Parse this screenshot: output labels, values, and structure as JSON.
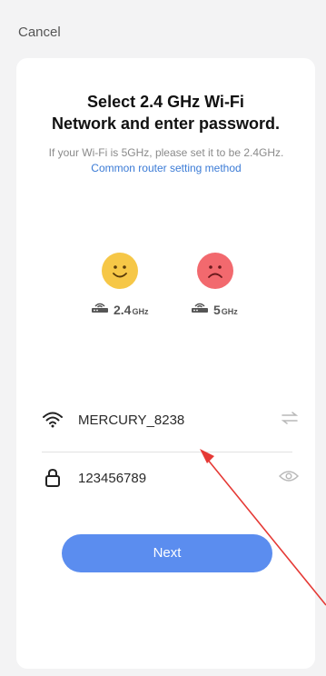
{
  "header": {
    "cancel_label": "Cancel"
  },
  "card": {
    "title_line1": "Select 2.4 GHz Wi-Fi",
    "title_line2": "Network and enter password.",
    "subtitle_text": "If your Wi-Fi is 5GHz, please set it to be 2.4GHz.",
    "subtitle_link": "Common router setting method"
  },
  "bands": [
    {
      "value": "2.4",
      "unit": "GHz",
      "status": "happy",
      "color": "#f6c747"
    },
    {
      "value": "5",
      "unit": "GHz",
      "status": "sad",
      "color": "#f2696e"
    }
  ],
  "form": {
    "ssid": "MERCURY_8238",
    "password": "123456789"
  },
  "actions": {
    "next_label": "Next"
  },
  "colors": {
    "accent": "#5b8def",
    "link": "#3b7bd6",
    "annotation_arrow": "#e53935"
  },
  "icons": [
    "wifi-icon",
    "swap-icon",
    "lock-icon",
    "eye-icon",
    "router-icon"
  ]
}
